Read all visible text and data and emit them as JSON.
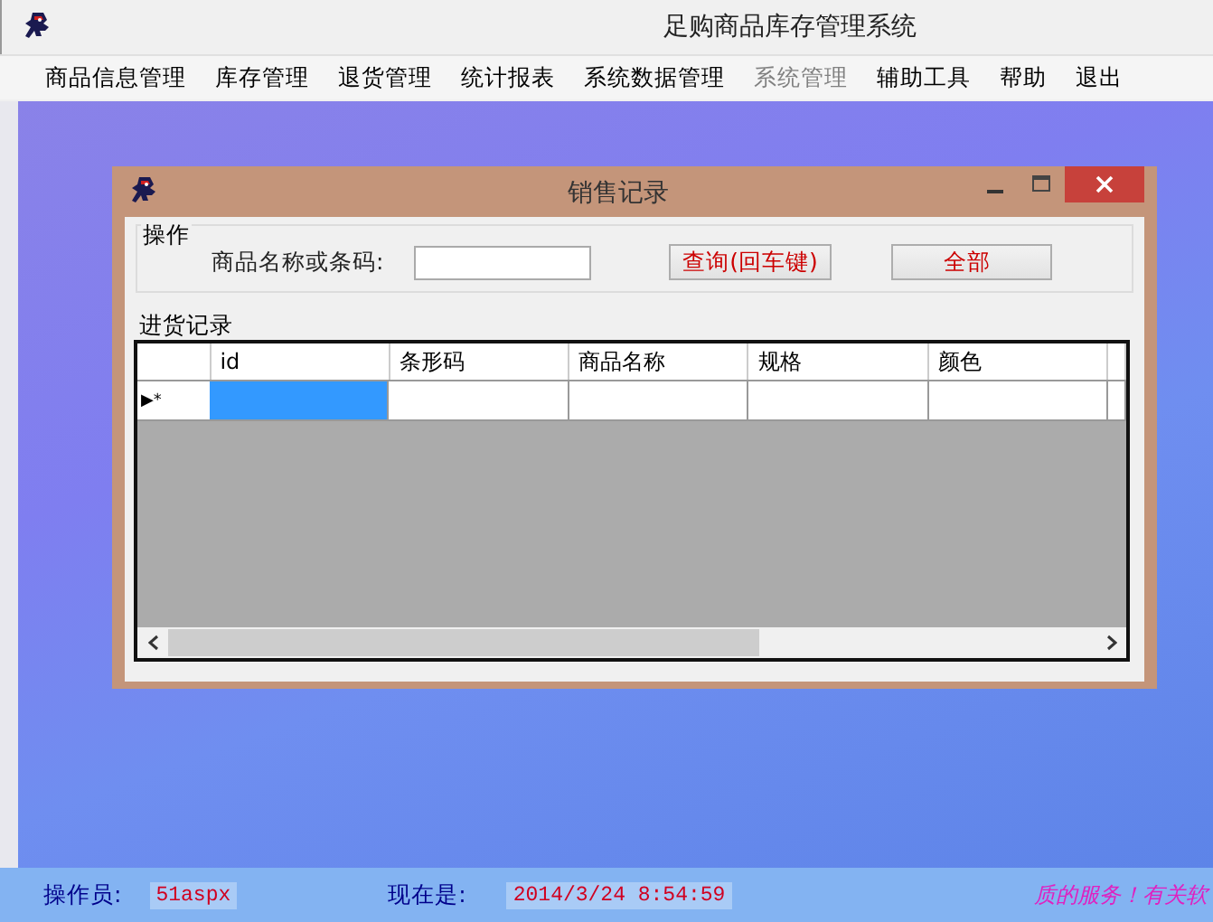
{
  "window": {
    "title": "足购商品库存管理系统"
  },
  "menu": [
    {
      "label": "商品信息管理",
      "disabled": false
    },
    {
      "label": "库存管理",
      "disabled": false
    },
    {
      "label": "退货管理",
      "disabled": false
    },
    {
      "label": "统计报表",
      "disabled": false
    },
    {
      "label": "系统数据管理",
      "disabled": false
    },
    {
      "label": "系统管理",
      "disabled": true
    },
    {
      "label": "辅助工具",
      "disabled": false
    },
    {
      "label": "帮助",
      "disabled": false
    },
    {
      "label": "退出",
      "disabled": false
    }
  ],
  "child_window": {
    "title": "销售记录",
    "operation_group": {
      "title": "操作",
      "search_label": "商品名称或条码:",
      "buttons": [
        "查询(回车键)",
        "全部"
      ]
    },
    "records_group": {
      "title": "进货记录",
      "table": {
        "columns": [
          "id",
          "条形码",
          "商品名称",
          "规格",
          "颜色"
        ],
        "rows": [
          {
            "indicator": "▶*",
            "cells": [
              {
                "selected": true
              },
              {
                "selected": false
              },
              {
                "selected": false
              },
              {
                "selected": false
              },
              {
                "selected": false
              }
            ]
          }
        ]
      }
    }
  },
  "status_bar": {
    "operator_label": "操作员:",
    "operator": "51aspx",
    "time_label": "现在是:",
    "time": "2014/3/24 8:54:59",
    "slogan": "质的服务！有关软"
  }
}
